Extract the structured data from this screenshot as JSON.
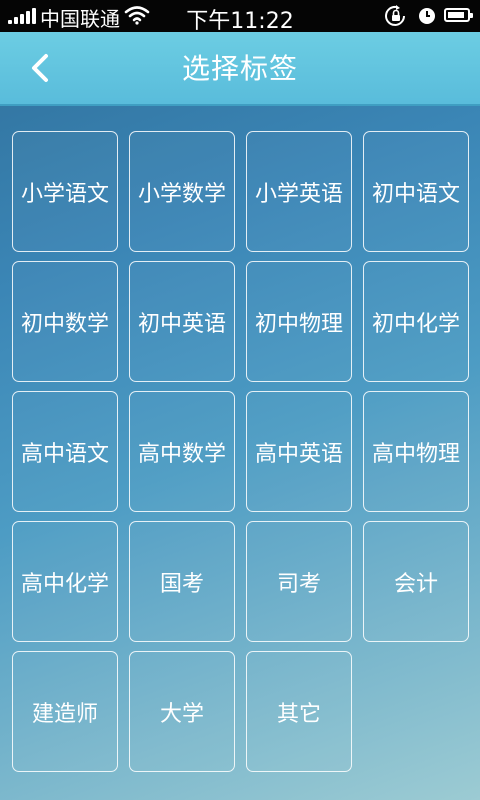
{
  "status_bar": {
    "carrier": "中国联通",
    "time": "下午11:22",
    "battery_level": 0.9
  },
  "header": {
    "title": "选择标签",
    "back_icon": "chevron-left-icon"
  },
  "tags": [
    "小学语文",
    "小学数学",
    "小学英语",
    "初中语文",
    "初中数学",
    "初中英语",
    "初中物理",
    "初中化学",
    "高中语文",
    "高中数学",
    "高中英语",
    "高中物理",
    "高中化学",
    "国考",
    "司考",
    "会计",
    "建造师",
    "大学",
    "其它"
  ],
  "colors": {
    "status_bar": "#050505",
    "header": "#5fc3df",
    "background_top": "#2f6f9a",
    "background_bottom": "#9ccbd3",
    "tag_border": "#ffffff",
    "text": "#ffffff"
  }
}
